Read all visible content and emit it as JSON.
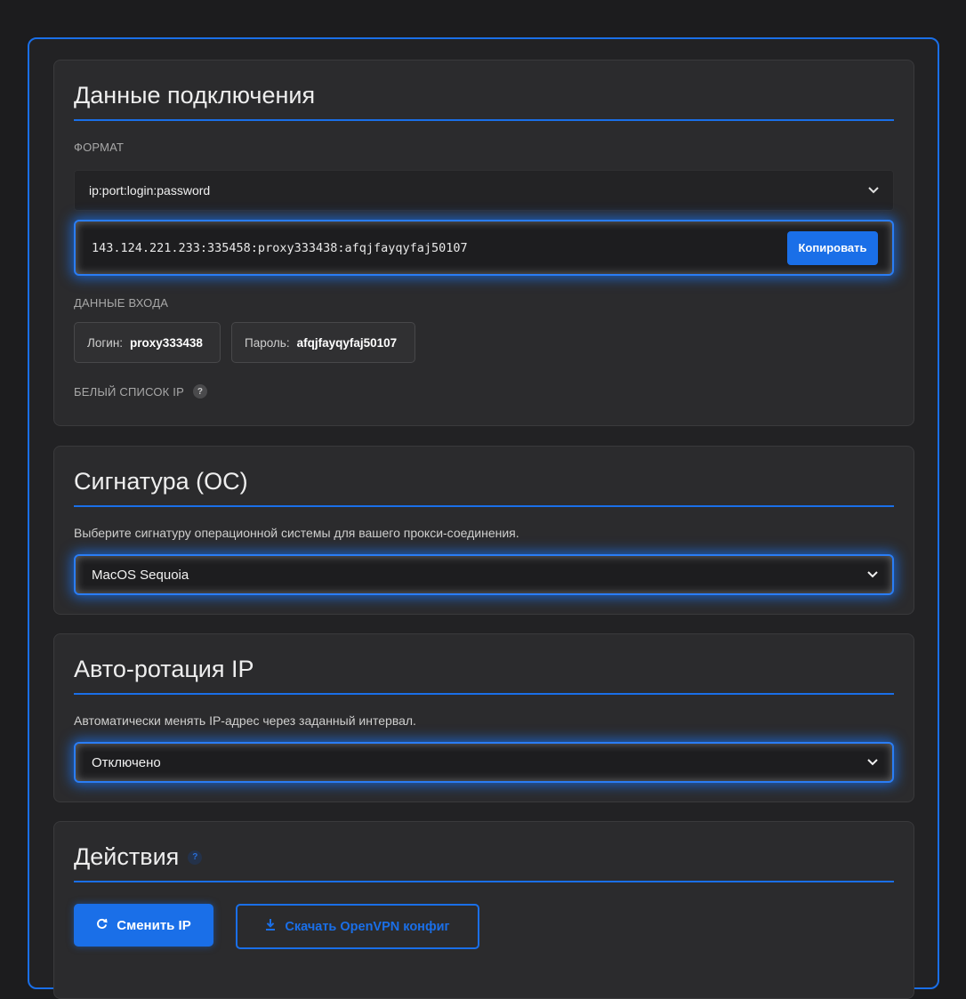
{
  "connection": {
    "title": "Данные подключения",
    "format_label": "ФОРМАТ",
    "format_value": "ip:port:login:password",
    "connection_string": "143.124.221.233:335458:proxy333438:afqjfayqyfaj50107",
    "copy_label": "Копировать",
    "login_section_label": "ДАННЫЕ ВХОДА",
    "login_key": "Логин:",
    "login_value": "proxy333438",
    "password_key": "Пароль:",
    "password_value": "afqjfayqyfaj50107",
    "whitelist_label": "БЕЛЫЙ СПИСОК IP",
    "help_glyph": "?"
  },
  "signature": {
    "title": "Сигнатура (ОС)",
    "description": "Выберите сигнатуру операционной системы для вашего прокси-соединения.",
    "selected": "MacOS Sequoia"
  },
  "rotation": {
    "title": "Авто-ротация IP",
    "description": "Автоматически менять IP-адрес через заданный интервал.",
    "selected": "Отключено"
  },
  "actions": {
    "title": "Действия",
    "help_glyph": "?",
    "change_ip_label": "Сменить IP",
    "download_label": "Скачать OpenVPN конфиг"
  },
  "colors": {
    "accent": "#1a6fe8",
    "background": "#1c1c1e",
    "card": "#2b2b2d"
  },
  "icons": [
    "chevron-down-icon",
    "refresh-icon",
    "download-icon",
    "help-icon"
  ]
}
